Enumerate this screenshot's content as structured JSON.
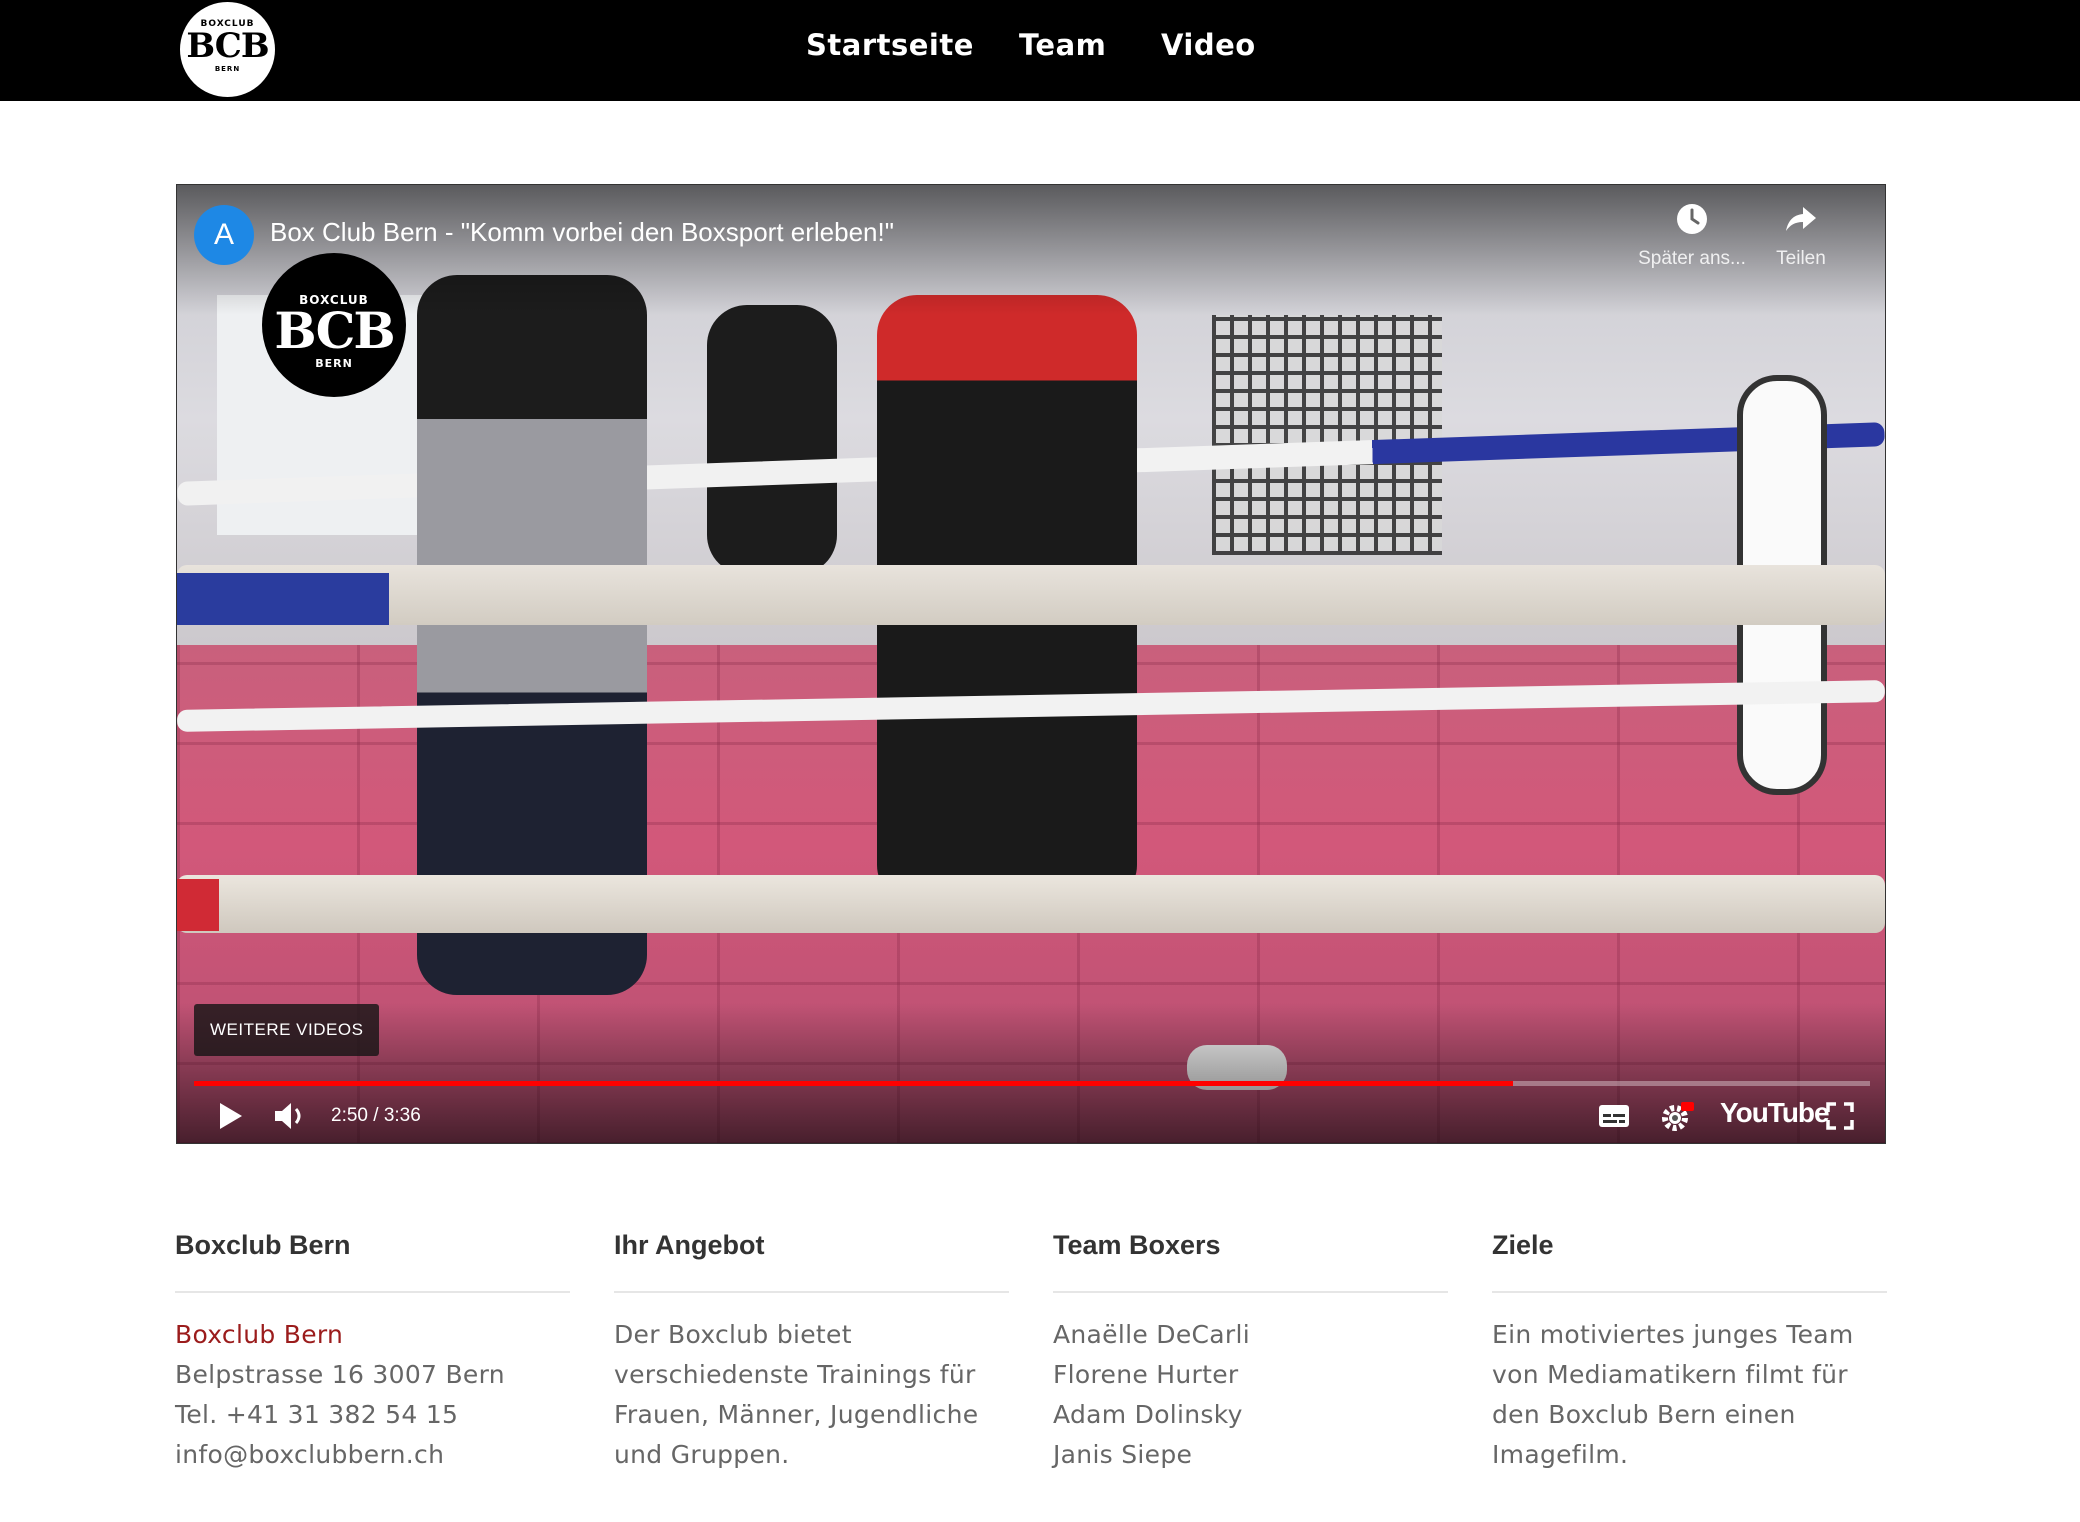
{
  "header": {
    "logo": {
      "top": "BOXCLUB",
      "mark": "BCB",
      "bottom": "BERN"
    },
    "nav": [
      {
        "label": "Startseite"
      },
      {
        "label": "Team"
      },
      {
        "label": "Video"
      }
    ]
  },
  "video": {
    "channel_avatar_letter": "A",
    "title": "Box Club Bern - \"Komm vorbei den Boxsport erleben!\"",
    "channel_logo": {
      "top": "BOXCLUB",
      "mark": "BCB",
      "bottom": "BERN"
    },
    "actions": {
      "watch_later": "Später ans...",
      "share": "Teilen"
    },
    "more_videos": "WEITERE VIDEOS",
    "time": "2:50 / 3:36",
    "progress_fraction": 0.787,
    "youtube_label": "YouTube",
    "colors": {
      "progress": "#ff0000",
      "avatar": "#1e88e5"
    }
  },
  "footer": {
    "columns": [
      {
        "heading": "Boxclub Bern",
        "accent_line": "Boxclub Bern",
        "lines": [
          "Belpstrasse 16 3007 Bern",
          "Tel. +41 31 382 54 15",
          "info@boxclubbern.ch"
        ]
      },
      {
        "heading": "Ihr Angebot",
        "lines": [
          "Der Boxclub bietet",
          "verschiedenste Trainings für",
          "Frauen, Männer, Jugendliche",
          "und Gruppen."
        ]
      },
      {
        "heading": "Team Boxers",
        "lines": [
          "Anaëlle DeCarli",
          "Florene Hurter",
          "Adam Dolinsky",
          "Janis Siepe"
        ]
      },
      {
        "heading": "Ziele",
        "lines": [
          "Ein motiviertes junges Team",
          "von Mediamatikern filmt für",
          "den Boxclub Bern einen",
          "Imagefilm."
        ]
      }
    ],
    "accent_color": "#9b1c1c"
  }
}
